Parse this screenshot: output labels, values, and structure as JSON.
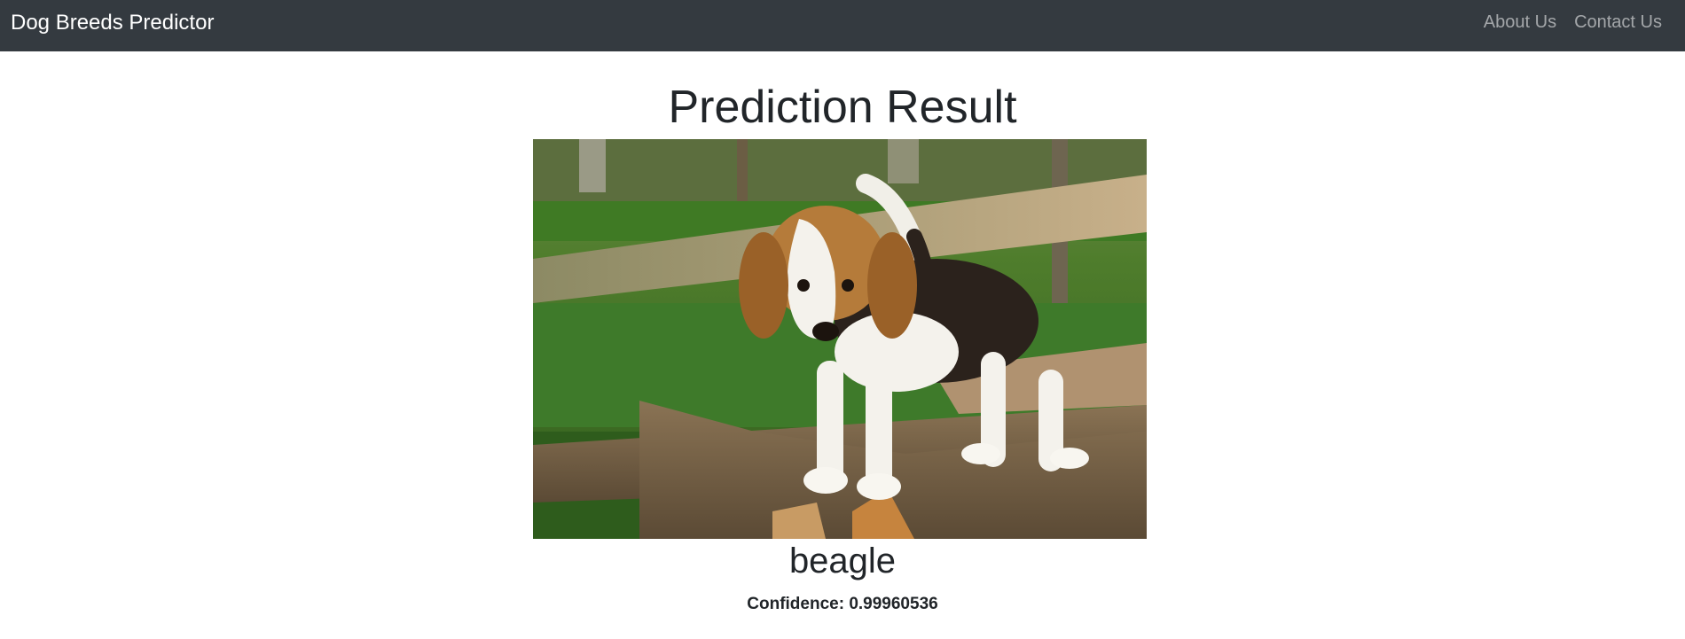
{
  "navbar": {
    "brand": "Dog Breeds Predictor",
    "links": [
      "About Us",
      "Contact Us"
    ],
    "background": "#343a40"
  },
  "page": {
    "title": "Prediction Result",
    "image_subject": "beagle puppy standing on a log in a grassy park",
    "prediction": "beagle",
    "confidence_label": "Confidence: 0.99960536"
  }
}
